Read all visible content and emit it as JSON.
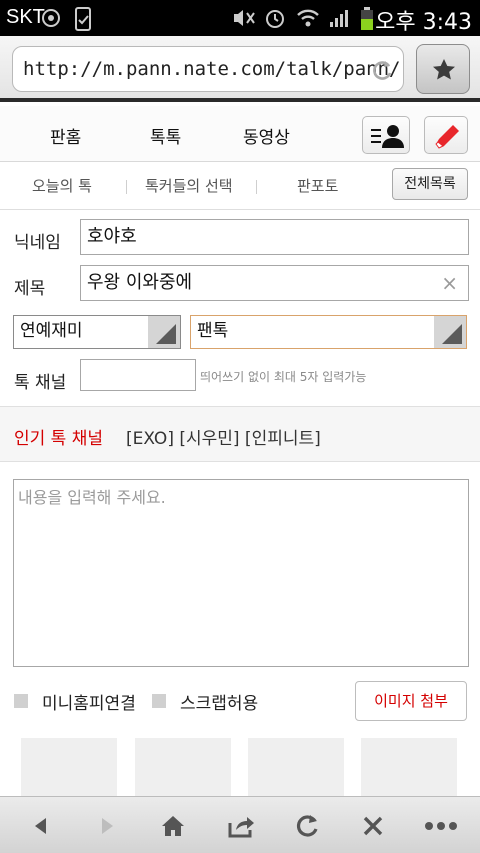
{
  "status_bar": {
    "carrier": "SKT",
    "time": "오후 3:43",
    "icons": [
      "media-icon",
      "checkbox-phone-icon",
      "mute-icon",
      "alarm-icon",
      "wifi-icon",
      "signal-icon",
      "battery-icon"
    ]
  },
  "browser": {
    "url": "http://m.pann.nate.com/talk/pann/",
    "bookmark_icon": "star-icon",
    "reload_icon": "reload-icon"
  },
  "nav": {
    "tabs": [
      "판홈",
      "톡톡",
      "동영상"
    ],
    "menu_icon": "list-user-icon",
    "write_icon": "pencil-icon"
  },
  "subnav": {
    "tabs": [
      "오늘의 톡",
      "톡커들의 선택",
      "판포토"
    ],
    "all_list_label": "전체목록"
  },
  "form": {
    "nickname_label": "닉네임",
    "nickname_value": "호야호",
    "title_label": "제목",
    "title_value": "우왕 이와중에",
    "category_value": "연예재미",
    "subcategory_value": "팬톡",
    "channel_label": "톡 채널",
    "channel_value": "",
    "channel_hint": "띄어쓰기 없이 최대 5자 입력가능",
    "popular_label": "인기 톡 채널",
    "popular_tags": "[EXO] [시우민] [인피니트]",
    "content_placeholder": "내용을 입력해 주세요.",
    "mini_homepage_label": "미니홈피연결",
    "scrap_label": "스크랩허용",
    "attach_image_label": "이미지 첨부"
  },
  "colors": {
    "accent_red": "#d40000",
    "url_bar_border": "#2a2a2a"
  }
}
